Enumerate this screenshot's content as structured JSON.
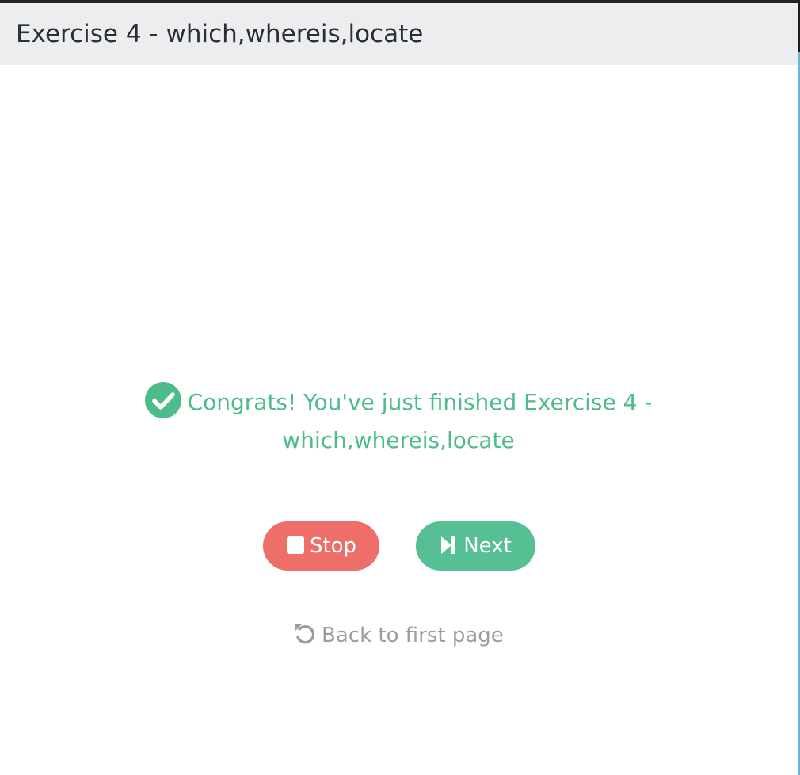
{
  "header": {
    "title": "Exercise 4 - which,whereis,locate"
  },
  "result": {
    "message_line1": "Congrats! You've just finished Exercise 4 -",
    "message_line2": "which,whereis,locate",
    "icon": "check-circle-icon"
  },
  "actions": {
    "stop_label": "Stop",
    "stop_icon": "stop-icon",
    "next_label": "Next",
    "next_icon": "skip-next-icon",
    "back_label": "Back to first page",
    "back_icon": "undo-icon"
  },
  "colors": {
    "success": "#4dbb8a",
    "stop_button": "#ee6e6a",
    "next_button": "#56bf94",
    "muted_link": "#9b9ea1",
    "header_bg": "#ecedef"
  }
}
